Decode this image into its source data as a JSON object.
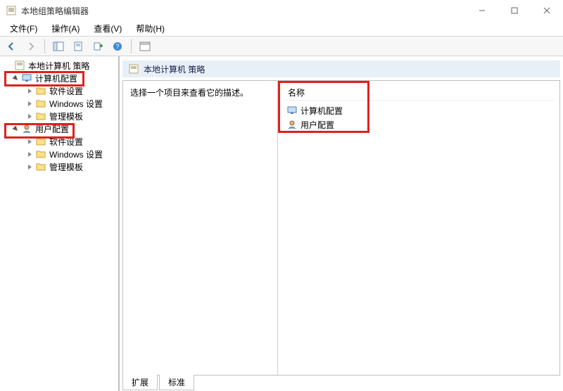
{
  "window": {
    "title": "本地组策略编辑器"
  },
  "menu": {
    "file": "文件(F)",
    "action": "操作(A)",
    "view": "查看(V)",
    "help": "帮助(H)"
  },
  "tree": {
    "root": "本地计算机 策略",
    "computer_cfg": "计算机配置",
    "software_settings": "软件设置",
    "windows_settings": "Windows 设置",
    "admin_templates": "管理模板",
    "user_cfg": "用户配置"
  },
  "content": {
    "header": "本地计算机 策略",
    "prompt": "选择一个项目来查看它的描述。",
    "col_name": "名称",
    "row_computer": "计算机配置",
    "row_user": "用户配置"
  },
  "tabs": {
    "extended": "扩展",
    "standard": "标准"
  }
}
